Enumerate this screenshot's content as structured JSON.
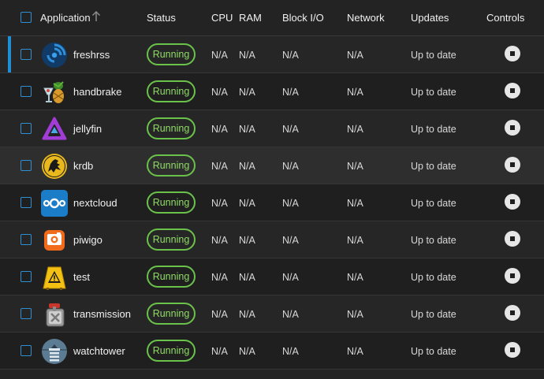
{
  "header": {
    "application": "Application",
    "status": "Status",
    "cpu": "CPU",
    "ram": "RAM",
    "block_io": "Block I/O",
    "network": "Network",
    "updates": "Updates",
    "controls": "Controls"
  },
  "apps": [
    {
      "name": "freshrss",
      "status": "Running",
      "cpu": "N/A",
      "ram": "N/A",
      "block_io": "N/A",
      "network": "N/A",
      "updates": "Up to date"
    },
    {
      "name": "handbrake",
      "status": "Running",
      "cpu": "N/A",
      "ram": "N/A",
      "block_io": "N/A",
      "network": "N/A",
      "updates": "Up to date"
    },
    {
      "name": "jellyfin",
      "status": "Running",
      "cpu": "N/A",
      "ram": "N/A",
      "block_io": "N/A",
      "network": "N/A",
      "updates": "Up to date"
    },
    {
      "name": "krdb",
      "status": "Running",
      "cpu": "N/A",
      "ram": "N/A",
      "block_io": "N/A",
      "network": "N/A",
      "updates": "Up to date"
    },
    {
      "name": "nextcloud",
      "status": "Running",
      "cpu": "N/A",
      "ram": "N/A",
      "block_io": "N/A",
      "network": "N/A",
      "updates": "Up to date"
    },
    {
      "name": "piwigo",
      "status": "Running",
      "cpu": "N/A",
      "ram": "N/A",
      "block_io": "N/A",
      "network": "N/A",
      "updates": "Up to date"
    },
    {
      "name": "test",
      "status": "Running",
      "cpu": "N/A",
      "ram": "N/A",
      "block_io": "N/A",
      "network": "N/A",
      "updates": "Up to date"
    },
    {
      "name": "transmission",
      "status": "Running",
      "cpu": "N/A",
      "ram": "N/A",
      "block_io": "N/A",
      "network": "N/A",
      "updates": "Up to date"
    },
    {
      "name": "watchtower",
      "status": "Running",
      "cpu": "N/A",
      "ram": "N/A",
      "block_io": "N/A",
      "network": "N/A",
      "updates": "Up to date"
    }
  ],
  "icons": [
    "freshrss-icon",
    "handbrake-icon",
    "jellyfin-icon",
    "krdb-icon",
    "nextcloud-icon",
    "piwigo-icon",
    "test-icon",
    "transmission-icon",
    "watchtower-icon"
  ],
  "colors": {
    "accent": "#1e8fd6",
    "running": "#6bc24a",
    "background": "#232323"
  }
}
